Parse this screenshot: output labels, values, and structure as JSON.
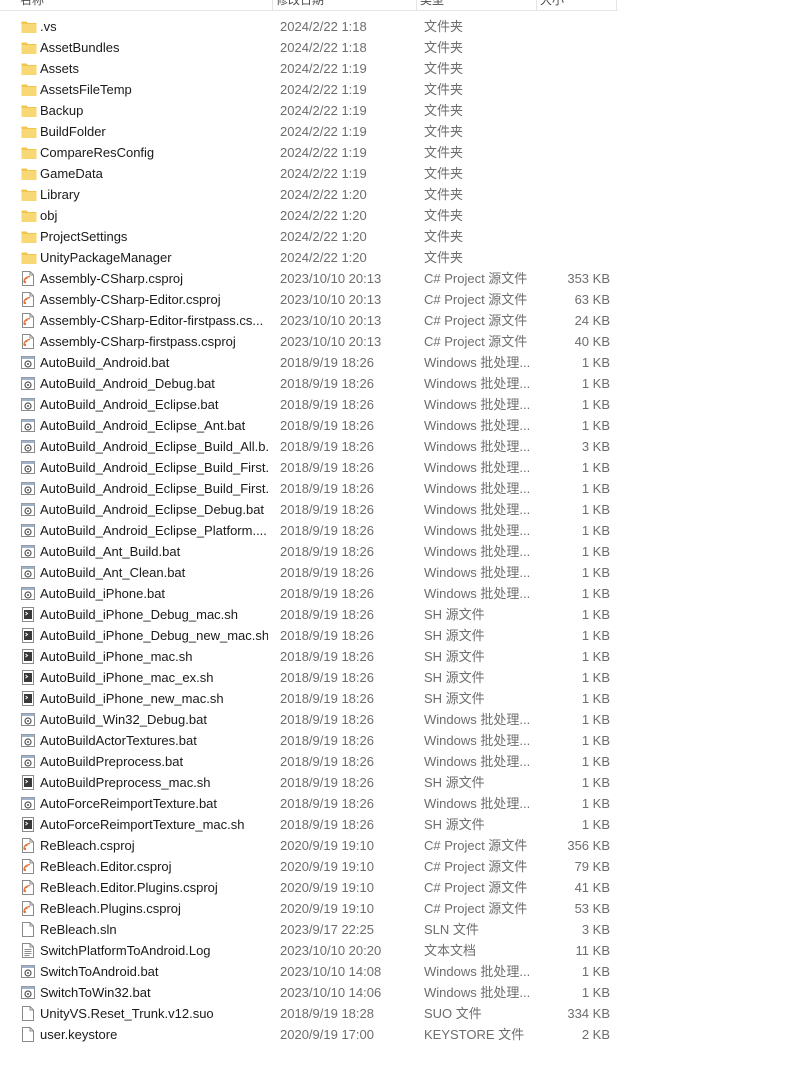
{
  "header": {
    "name": "名称",
    "date": "修改日期",
    "type": "类型",
    "size": "大小"
  },
  "colors": {
    "folder": "#f4c54c",
    "csproj_accent": "#e3743c",
    "text": "#1a1a1a",
    "muted": "#6d6d6d"
  },
  "files": [
    {
      "name": ".vs",
      "date": "2024/2/22 1:18",
      "type": "文件夹",
      "size": "",
      "icon": "folder-icon"
    },
    {
      "name": "AssetBundles",
      "date": "2024/2/22 1:18",
      "type": "文件夹",
      "size": "",
      "icon": "folder-icon"
    },
    {
      "name": "Assets",
      "date": "2024/2/22 1:19",
      "type": "文件夹",
      "size": "",
      "icon": "folder-icon"
    },
    {
      "name": "AssetsFileTemp",
      "date": "2024/2/22 1:19",
      "type": "文件夹",
      "size": "",
      "icon": "folder-icon"
    },
    {
      "name": "Backup",
      "date": "2024/2/22 1:19",
      "type": "文件夹",
      "size": "",
      "icon": "folder-icon"
    },
    {
      "name": "BuildFolder",
      "date": "2024/2/22 1:19",
      "type": "文件夹",
      "size": "",
      "icon": "folder-icon"
    },
    {
      "name": "CompareResConfig",
      "date": "2024/2/22 1:19",
      "type": "文件夹",
      "size": "",
      "icon": "folder-icon"
    },
    {
      "name": "GameData",
      "date": "2024/2/22 1:19",
      "type": "文件夹",
      "size": "",
      "icon": "folder-icon"
    },
    {
      "name": "Library",
      "date": "2024/2/22 1:20",
      "type": "文件夹",
      "size": "",
      "icon": "folder-icon"
    },
    {
      "name": "obj",
      "date": "2024/2/22 1:20",
      "type": "文件夹",
      "size": "",
      "icon": "folder-icon"
    },
    {
      "name": "ProjectSettings",
      "date": "2024/2/22 1:20",
      "type": "文件夹",
      "size": "",
      "icon": "folder-icon"
    },
    {
      "name": "UnityPackageManager",
      "date": "2024/2/22 1:20",
      "type": "文件夹",
      "size": "",
      "icon": "folder-icon"
    },
    {
      "name": "Assembly-CSharp.csproj",
      "date": "2023/10/10 20:13",
      "type": "C# Project 源文件",
      "size": "353 KB",
      "icon": "csproj-file-icon"
    },
    {
      "name": "Assembly-CSharp-Editor.csproj",
      "date": "2023/10/10 20:13",
      "type": "C# Project 源文件",
      "size": "63 KB",
      "icon": "csproj-file-icon"
    },
    {
      "name": "Assembly-CSharp-Editor-firstpass.cs...",
      "date": "2023/10/10 20:13",
      "type": "C# Project 源文件",
      "size": "24 KB",
      "icon": "csproj-file-icon"
    },
    {
      "name": "Assembly-CSharp-firstpass.csproj",
      "date": "2023/10/10 20:13",
      "type": "C# Project 源文件",
      "size": "40 KB",
      "icon": "csproj-file-icon"
    },
    {
      "name": "AutoBuild_Android.bat",
      "date": "2018/9/19 18:26",
      "type": "Windows 批处理...",
      "size": "1 KB",
      "icon": "batch-file-icon"
    },
    {
      "name": "AutoBuild_Android_Debug.bat",
      "date": "2018/9/19 18:26",
      "type": "Windows 批处理...",
      "size": "1 KB",
      "icon": "batch-file-icon"
    },
    {
      "name": "AutoBuild_Android_Eclipse.bat",
      "date": "2018/9/19 18:26",
      "type": "Windows 批处理...",
      "size": "1 KB",
      "icon": "batch-file-icon"
    },
    {
      "name": "AutoBuild_Android_Eclipse_Ant.bat",
      "date": "2018/9/19 18:26",
      "type": "Windows 批处理...",
      "size": "1 KB",
      "icon": "batch-file-icon"
    },
    {
      "name": "AutoBuild_Android_Eclipse_Build_All.b...",
      "date": "2018/9/19 18:26",
      "type": "Windows 批处理...",
      "size": "3 KB",
      "icon": "batch-file-icon"
    },
    {
      "name": "AutoBuild_Android_Eclipse_Build_First...",
      "date": "2018/9/19 18:26",
      "type": "Windows 批处理...",
      "size": "1 KB",
      "icon": "batch-file-icon"
    },
    {
      "name": "AutoBuild_Android_Eclipse_Build_First...",
      "date": "2018/9/19 18:26",
      "type": "Windows 批处理...",
      "size": "1 KB",
      "icon": "batch-file-icon"
    },
    {
      "name": "AutoBuild_Android_Eclipse_Debug.bat",
      "date": "2018/9/19 18:26",
      "type": "Windows 批处理...",
      "size": "1 KB",
      "icon": "batch-file-icon"
    },
    {
      "name": "AutoBuild_Android_Eclipse_Platform....",
      "date": "2018/9/19 18:26",
      "type": "Windows 批处理...",
      "size": "1 KB",
      "icon": "batch-file-icon"
    },
    {
      "name": "AutoBuild_Ant_Build.bat",
      "date": "2018/9/19 18:26",
      "type": "Windows 批处理...",
      "size": "1 KB",
      "icon": "batch-file-icon"
    },
    {
      "name": "AutoBuild_Ant_Clean.bat",
      "date": "2018/9/19 18:26",
      "type": "Windows 批处理...",
      "size": "1 KB",
      "icon": "batch-file-icon"
    },
    {
      "name": "AutoBuild_iPhone.bat",
      "date": "2018/9/19 18:26",
      "type": "Windows 批处理...",
      "size": "1 KB",
      "icon": "batch-file-icon"
    },
    {
      "name": "AutoBuild_iPhone_Debug_mac.sh",
      "date": "2018/9/19 18:26",
      "type": "SH 源文件",
      "size": "1 KB",
      "icon": "sh-file-icon"
    },
    {
      "name": "AutoBuild_iPhone_Debug_new_mac.sh",
      "date": "2018/9/19 18:26",
      "type": "SH 源文件",
      "size": "1 KB",
      "icon": "sh-file-icon"
    },
    {
      "name": "AutoBuild_iPhone_mac.sh",
      "date": "2018/9/19 18:26",
      "type": "SH 源文件",
      "size": "1 KB",
      "icon": "sh-file-icon"
    },
    {
      "name": "AutoBuild_iPhone_mac_ex.sh",
      "date": "2018/9/19 18:26",
      "type": "SH 源文件",
      "size": "1 KB",
      "icon": "sh-file-icon"
    },
    {
      "name": "AutoBuild_iPhone_new_mac.sh",
      "date": "2018/9/19 18:26",
      "type": "SH 源文件",
      "size": "1 KB",
      "icon": "sh-file-icon"
    },
    {
      "name": "AutoBuild_Win32_Debug.bat",
      "date": "2018/9/19 18:26",
      "type": "Windows 批处理...",
      "size": "1 KB",
      "icon": "batch-file-icon"
    },
    {
      "name": "AutoBuildActorTextures.bat",
      "date": "2018/9/19 18:26",
      "type": "Windows 批处理...",
      "size": "1 KB",
      "icon": "batch-file-icon"
    },
    {
      "name": "AutoBuildPreprocess.bat",
      "date": "2018/9/19 18:26",
      "type": "Windows 批处理...",
      "size": "1 KB",
      "icon": "batch-file-icon"
    },
    {
      "name": "AutoBuildPreprocess_mac.sh",
      "date": "2018/9/19 18:26",
      "type": "SH 源文件",
      "size": "1 KB",
      "icon": "sh-file-icon"
    },
    {
      "name": "AutoForceReimportTexture.bat",
      "date": "2018/9/19 18:26",
      "type": "Windows 批处理...",
      "size": "1 KB",
      "icon": "batch-file-icon"
    },
    {
      "name": "AutoForceReimportTexture_mac.sh",
      "date": "2018/9/19 18:26",
      "type": "SH 源文件",
      "size": "1 KB",
      "icon": "sh-file-icon"
    },
    {
      "name": "ReBleach.csproj",
      "date": "2020/9/19 19:10",
      "type": "C# Project 源文件",
      "size": "356 KB",
      "icon": "csproj-file-icon"
    },
    {
      "name": "ReBleach.Editor.csproj",
      "date": "2020/9/19 19:10",
      "type": "C# Project 源文件",
      "size": "79 KB",
      "icon": "csproj-file-icon"
    },
    {
      "name": "ReBleach.Editor.Plugins.csproj",
      "date": "2020/9/19 19:10",
      "type": "C# Project 源文件",
      "size": "41 KB",
      "icon": "csproj-file-icon"
    },
    {
      "name": "ReBleach.Plugins.csproj",
      "date": "2020/9/19 19:10",
      "type": "C# Project 源文件",
      "size": "53 KB",
      "icon": "csproj-file-icon"
    },
    {
      "name": "ReBleach.sln",
      "date": "2023/9/17 22:25",
      "type": "SLN 文件",
      "size": "3 KB",
      "icon": "blank-file-icon"
    },
    {
      "name": "SwitchPlatformToAndroid.Log",
      "date": "2023/10/10 20:20",
      "type": "文本文档",
      "size": "11 KB",
      "icon": "text-file-icon"
    },
    {
      "name": "SwitchToAndroid.bat",
      "date": "2023/10/10 14:08",
      "type": "Windows 批处理...",
      "size": "1 KB",
      "icon": "batch-file-icon"
    },
    {
      "name": "SwitchToWin32.bat",
      "date": "2023/10/10 14:06",
      "type": "Windows 批处理...",
      "size": "1 KB",
      "icon": "batch-file-icon"
    },
    {
      "name": "UnityVS.Reset_Trunk.v12.suo",
      "date": "2018/9/19 18:28",
      "type": "SUO 文件",
      "size": "334 KB",
      "icon": "blank-file-icon"
    },
    {
      "name": "user.keystore",
      "date": "2020/9/19 17:00",
      "type": "KEYSTORE 文件",
      "size": "2 KB",
      "icon": "blank-file-icon"
    }
  ]
}
